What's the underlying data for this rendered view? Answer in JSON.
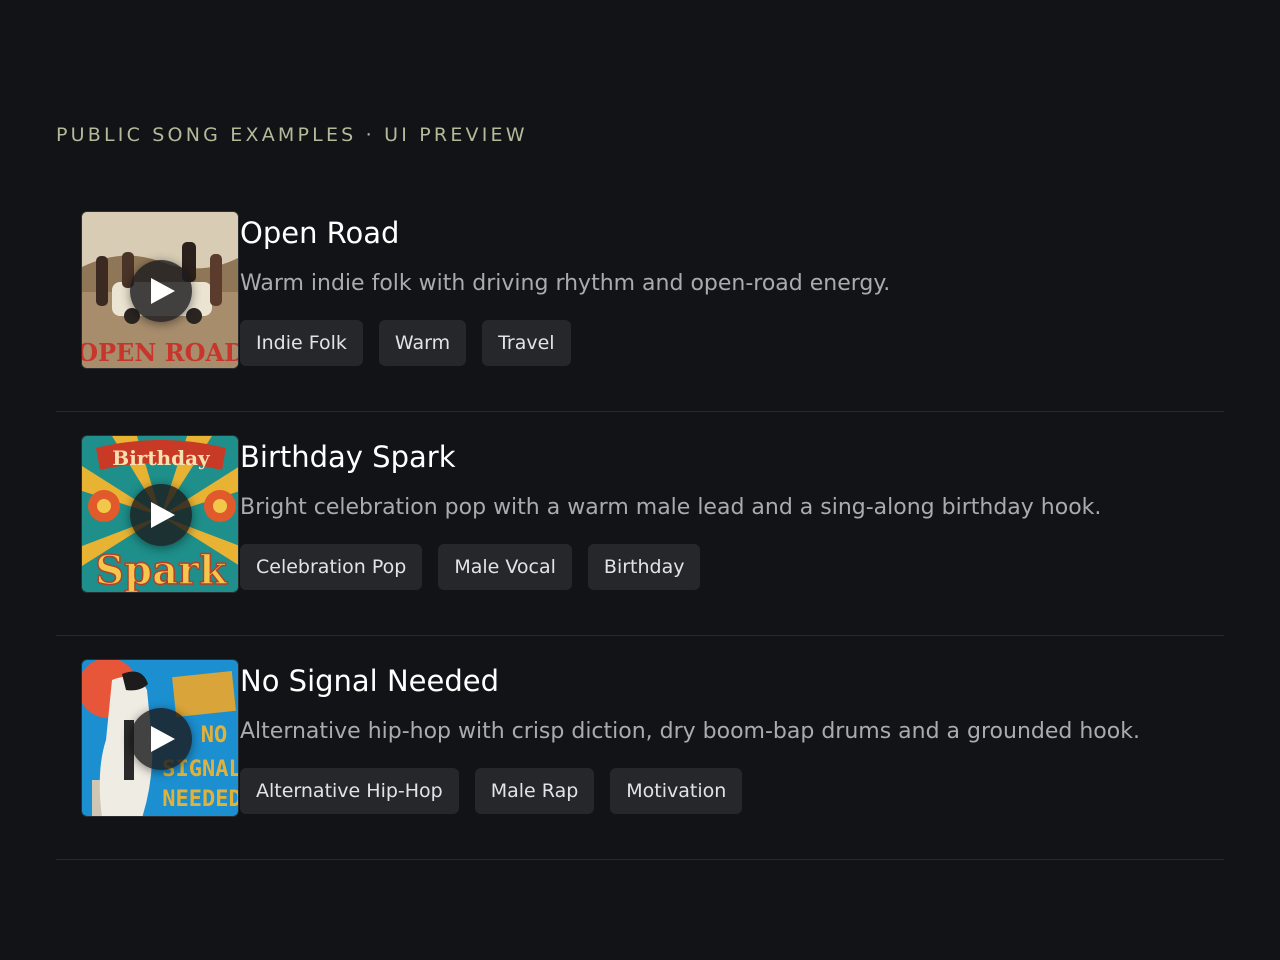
{
  "header": {
    "eyebrow": "PUBLIC SONG EXAMPLES · UI PREVIEW"
  },
  "songs": [
    {
      "title": "Open Road",
      "description": "Warm indie folk with driving rhythm and open-road energy.",
      "cover_text": "OPEN ROAD",
      "tags": [
        "Indie Folk",
        "Warm",
        "Travel"
      ]
    },
    {
      "title": "Birthday Spark",
      "description": "Bright celebration pop with a warm male lead and a sing-along birthday hook.",
      "cover_text_top": "Birthday",
      "cover_text_bottom": "Spark",
      "tags": [
        "Celebration Pop",
        "Male Vocal",
        "Birthday"
      ]
    },
    {
      "title": "No Signal Needed",
      "description": "Alternative hip-hop with crisp diction, dry boom-bap drums and a grounded hook.",
      "cover_text_top": "NO",
      "cover_text_mid": "SIGNAL",
      "cover_text_bottom": "NEEDED",
      "tags": [
        "Alternative Hip-Hop",
        "Male Rap",
        "Motivation"
      ]
    }
  ],
  "icons": {
    "play": "play-icon"
  },
  "colors": {
    "background": "#111316",
    "eyebrow": "#b5b99a",
    "tag_bg": "#25272b",
    "muted_text": "#a9abaf"
  }
}
